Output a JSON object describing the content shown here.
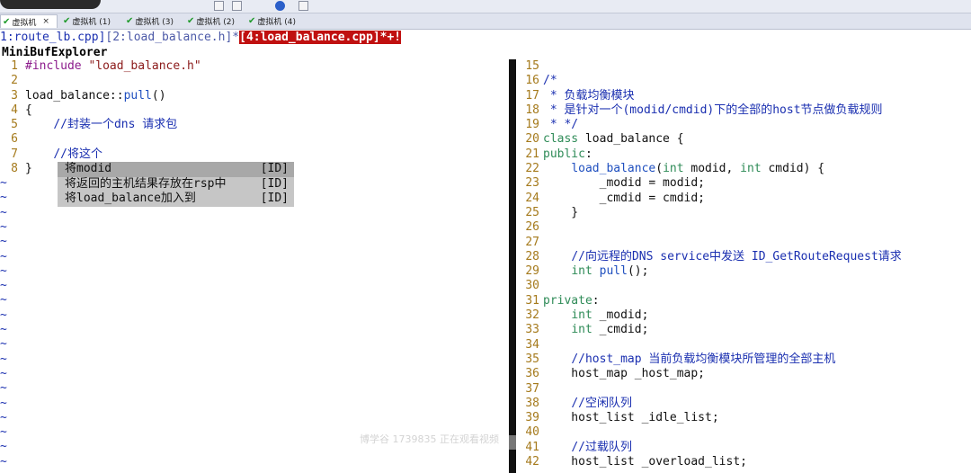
{
  "tabs": [
    {
      "label": "虚拟机",
      "active": true
    },
    {
      "label": "虚拟机 (1)",
      "active": false
    },
    {
      "label": "虚拟机 (3)",
      "active": false
    },
    {
      "label": "虚拟机 (2)",
      "active": false
    },
    {
      "label": "虚拟机 (4)",
      "active": false
    }
  ],
  "tab_close": "×",
  "buffer_line": {
    "b1": "1:route_lb.cpp]",
    "b2": "[2:load_balance.h]*",
    "b3": "[4:load_balance.cpp]*+!"
  },
  "mbe_title": "MiniBufExplorer",
  "left_lines": [
    {
      "n": "1",
      "segs": [
        [
          "pp",
          "#include "
        ],
        [
          "str",
          "\"load_balance.h\""
        ]
      ]
    },
    {
      "n": "2",
      "segs": []
    },
    {
      "n": "3",
      "segs": [
        [
          "pl",
          "load_balance::"
        ],
        [
          "fn",
          "pull"
        ],
        [
          "pl",
          "()"
        ]
      ]
    },
    {
      "n": "4",
      "segs": [
        [
          "pl",
          "{"
        ]
      ]
    },
    {
      "n": "5",
      "segs": [
        [
          "pl",
          "    "
        ],
        [
          "cm",
          "//封装一个dns 请求包"
        ]
      ]
    },
    {
      "n": "6",
      "segs": []
    },
    {
      "n": "7",
      "segs": [
        [
          "pl",
          "    "
        ],
        [
          "cm",
          "//将这个"
        ]
      ]
    },
    {
      "n": "8",
      "segs": [
        [
          "pl",
          "}"
        ]
      ]
    }
  ],
  "tilde": "~",
  "popup": [
    {
      "text": "将modid",
      "tag": "[ID]"
    },
    {
      "text": "将返回的主机结果存放在rsp中",
      "tag": "[ID]"
    },
    {
      "text": "将load_balance加入到",
      "tag": "[ID]"
    }
  ],
  "right_lines": [
    {
      "n": "15",
      "segs": []
    },
    {
      "n": "16",
      "segs": [
        [
          "cm",
          "/*"
        ]
      ]
    },
    {
      "n": "17",
      "segs": [
        [
          "cm",
          " * 负载均衡模块"
        ]
      ]
    },
    {
      "n": "18",
      "segs": [
        [
          "cm",
          " * 是针对一个(modid/cmdid)下的全部的host节点做负载规则"
        ]
      ]
    },
    {
      "n": "19",
      "segs": [
        [
          "cm",
          " * */"
        ]
      ]
    },
    {
      "n": "20",
      "segs": [
        [
          "kw",
          "class"
        ],
        [
          "pl",
          " load_balance {"
        ]
      ]
    },
    {
      "n": "21",
      "segs": [
        [
          "kw",
          "public"
        ],
        [
          "pl",
          ":"
        ]
      ]
    },
    {
      "n": "22",
      "segs": [
        [
          "pl",
          "    "
        ],
        [
          "fn",
          "load_balance"
        ],
        [
          "pl",
          "("
        ],
        [
          "tp",
          "int"
        ],
        [
          "pl",
          " modid, "
        ],
        [
          "tp",
          "int"
        ],
        [
          "pl",
          " cmdid) {"
        ]
      ]
    },
    {
      "n": "23",
      "segs": [
        [
          "pl",
          "        _modid = modid;"
        ]
      ]
    },
    {
      "n": "24",
      "segs": [
        [
          "pl",
          "        _cmdid = cmdid;"
        ]
      ]
    },
    {
      "n": "25",
      "segs": [
        [
          "pl",
          "    }"
        ]
      ]
    },
    {
      "n": "26",
      "segs": []
    },
    {
      "n": "27",
      "segs": []
    },
    {
      "n": "28",
      "segs": [
        [
          "pl",
          "    "
        ],
        [
          "cm",
          "//向远程的DNS service中发送 ID_GetRouteRequest请求"
        ]
      ]
    },
    {
      "n": "29",
      "segs": [
        [
          "pl",
          "    "
        ],
        [
          "tp",
          "int"
        ],
        [
          "pl",
          " "
        ],
        [
          "fn",
          "pull"
        ],
        [
          "pl",
          "();"
        ]
      ]
    },
    {
      "n": "30",
      "segs": []
    },
    {
      "n": "31",
      "segs": [
        [
          "kw",
          "private"
        ],
        [
          "pl",
          ":"
        ]
      ]
    },
    {
      "n": "32",
      "segs": [
        [
          "pl",
          "    "
        ],
        [
          "tp",
          "int"
        ],
        [
          "pl",
          " _modid;"
        ]
      ]
    },
    {
      "n": "33",
      "segs": [
        [
          "pl",
          "    "
        ],
        [
          "tp",
          "int"
        ],
        [
          "pl",
          " _cmdid;"
        ]
      ]
    },
    {
      "n": "34",
      "segs": []
    },
    {
      "n": "35",
      "segs": [
        [
          "pl",
          "    "
        ],
        [
          "cm",
          "//host_map 当前负载均衡模块所管理的全部主机"
        ]
      ]
    },
    {
      "n": "36",
      "segs": [
        [
          "pl",
          "    host_map _host_map;"
        ]
      ]
    },
    {
      "n": "37",
      "segs": []
    },
    {
      "n": "38",
      "segs": [
        [
          "pl",
          "    "
        ],
        [
          "cm",
          "//空闲队列"
        ]
      ]
    },
    {
      "n": "39",
      "segs": [
        [
          "pl",
          "    host_list _idle_list;"
        ]
      ]
    },
    {
      "n": "40",
      "segs": []
    },
    {
      "n": "41",
      "segs": [
        [
          "pl",
          "    "
        ],
        [
          "cm",
          "//过载队列"
        ]
      ]
    },
    {
      "n": "42",
      "segs": [
        [
          "pl",
          "    host_list _overload_list;"
        ]
      ]
    }
  ],
  "watermark": "博学谷 1739835 正在观看视频"
}
